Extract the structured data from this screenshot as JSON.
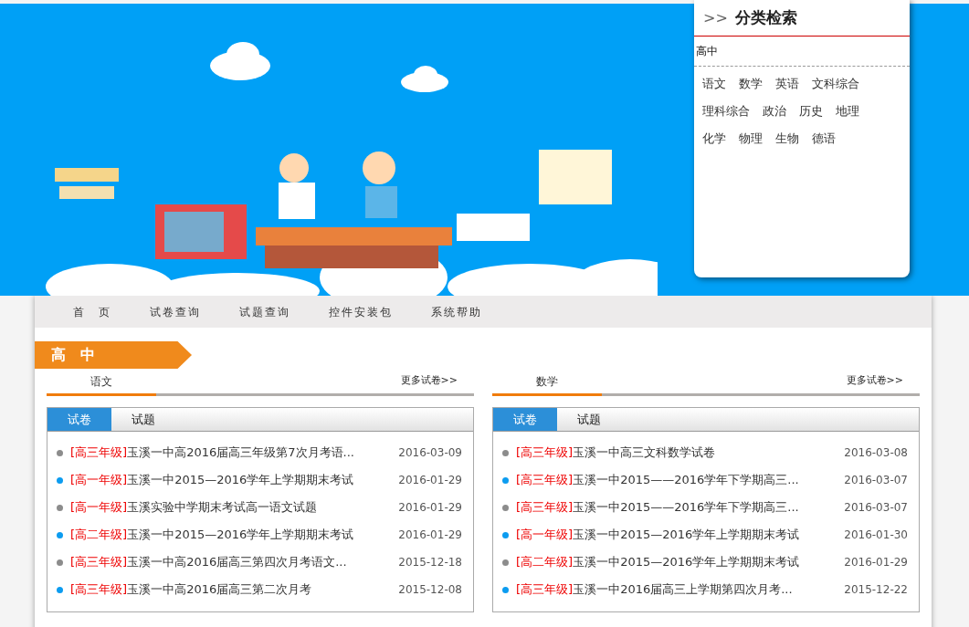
{
  "category_panel": {
    "arrow": ">>",
    "title": "分类检索",
    "level_label": "高中",
    "subjects": [
      "语文",
      "数学",
      "英语",
      "文科综合",
      "理科综合",
      "政治",
      "历史",
      "地理",
      "化学",
      "物理",
      "生物",
      "德语"
    ]
  },
  "nav": [
    "首　页",
    "试卷查询",
    "试题查询",
    "控件安装包",
    "系统帮助"
  ],
  "section_title": "高　中",
  "columns": [
    {
      "subject": "语文",
      "more": "更多试卷>>",
      "tabs": [
        {
          "label": "试卷",
          "selected": true
        },
        {
          "label": "试题",
          "selected": false
        }
      ],
      "items": [
        {
          "grade": "[高三年级]",
          "title": "玉溪一中高2016届高三年级第7次月考语...",
          "date": "2016-03-09",
          "color": "#8c8c8c"
        },
        {
          "grade": "[高一年级]",
          "title": "玉溪一中2015—2016学年上学期期末考试",
          "date": "2016-01-29",
          "color": "#0c9cf0"
        },
        {
          "grade": "[高一年级]",
          "title": "玉溪实验中学期末考试高一语文试题",
          "date": "2016-01-29",
          "color": "#8c8c8c"
        },
        {
          "grade": "[高二年级]",
          "title": "玉溪一中2015—2016学年上学期期末考试",
          "date": "2016-01-29",
          "color": "#0c9cf0"
        },
        {
          "grade": "[高三年级]",
          "title": "玉溪一中高2016届高三第四次月考语文...",
          "date": "2015-12-18",
          "color": "#8c8c8c"
        },
        {
          "grade": "[高三年级]",
          "title": "玉溪一中高2016届高三第二次月考",
          "date": "2015-12-08",
          "color": "#0c9cf0"
        }
      ]
    },
    {
      "subject": "数学",
      "more": "更多试卷>>",
      "tabs": [
        {
          "label": "试卷",
          "selected": true
        },
        {
          "label": "试题",
          "selected": false
        }
      ],
      "items": [
        {
          "grade": "[高三年级]",
          "title": "玉溪一中高三文科数学试卷",
          "date": "2016-03-08",
          "color": "#8c8c8c"
        },
        {
          "grade": "[高三年级]",
          "title": "玉溪一中2015——2016学年下学期高三...",
          "date": "2016-03-07",
          "color": "#0c9cf0"
        },
        {
          "grade": "[高三年级]",
          "title": "玉溪一中2015——2016学年下学期高三...",
          "date": "2016-03-07",
          "color": "#8c8c8c"
        },
        {
          "grade": "[高一年级]",
          "title": "玉溪一中2015—2016学年上学期期末考试",
          "date": "2016-01-30",
          "color": "#0c9cf0"
        },
        {
          "grade": "[高二年级]",
          "title": "玉溪一中2015—2016学年上学期期末考试",
          "date": "2016-01-29",
          "color": "#8c8c8c"
        },
        {
          "grade": "[高三年级]",
          "title": "玉溪一中2016届高三上学期第四次月考...",
          "date": "2015-12-22",
          "color": "#0c9cf0"
        }
      ]
    }
  ]
}
